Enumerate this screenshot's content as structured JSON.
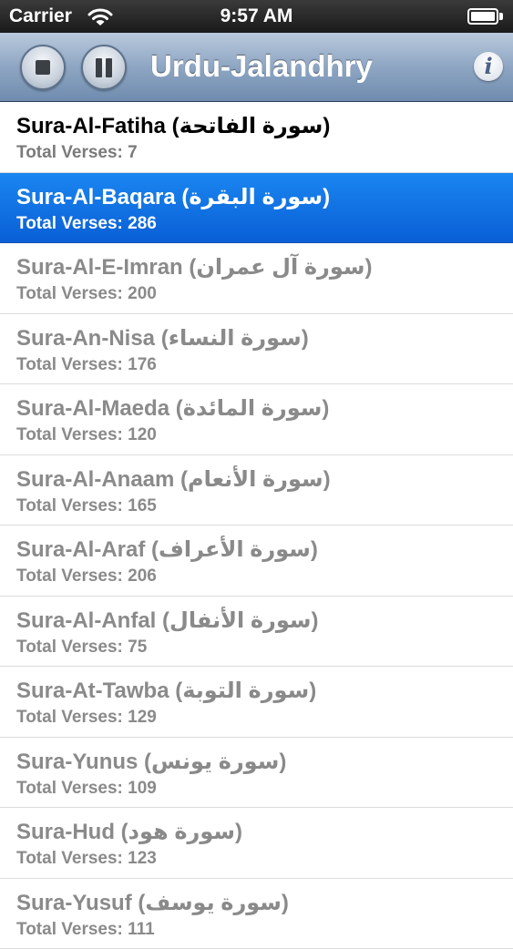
{
  "status_bar": {
    "carrier": "Carrier",
    "time": "9:57 AM"
  },
  "nav_bar": {
    "title": "Urdu-Jalandhry",
    "stop_icon": "stop-icon",
    "pause_icon": "pause-icon",
    "info_label": "i"
  },
  "colors": {
    "selection": "#0a5fd6",
    "nav_bar": "#8ea6c3"
  },
  "list": {
    "selected_index": 1,
    "items": [
      {
        "title": "Sura-Al-Fatiha (سورة الفاتحة)",
        "verses": "Total Verses: 7"
      },
      {
        "title": "Sura-Al-Baqara (سورة البقرة)",
        "verses": "Total Verses: 286"
      },
      {
        "title": "Sura-Al-E-Imran (سورة آل عمران)",
        "verses": "Total Verses: 200"
      },
      {
        "title": "Sura-An-Nisa (سورة النساء)",
        "verses": "Total Verses: 176"
      },
      {
        "title": "Sura-Al-Maeda (سورة المائدة)",
        "verses": "Total Verses: 120"
      },
      {
        "title": "Sura-Al-Anaam (سورة الأنعام)",
        "verses": "Total Verses: 165"
      },
      {
        "title": "Sura-Al-Araf (سورة الأعراف)",
        "verses": "Total Verses: 206"
      },
      {
        "title": "Sura-Al-Anfal (سورة الأنفال)",
        "verses": "Total Verses: 75"
      },
      {
        "title": "Sura-At-Tawba (سورة التوبة)",
        "verses": "Total Verses: 129"
      },
      {
        "title": "Sura-Yunus (سورة يونس)",
        "verses": "Total Verses: 109"
      },
      {
        "title": "Sura-Hud (سورة هود)",
        "verses": "Total Verses: 123"
      },
      {
        "title": "Sura-Yusuf (سورة يوسف)",
        "verses": "Total Verses: 111"
      }
    ]
  }
}
